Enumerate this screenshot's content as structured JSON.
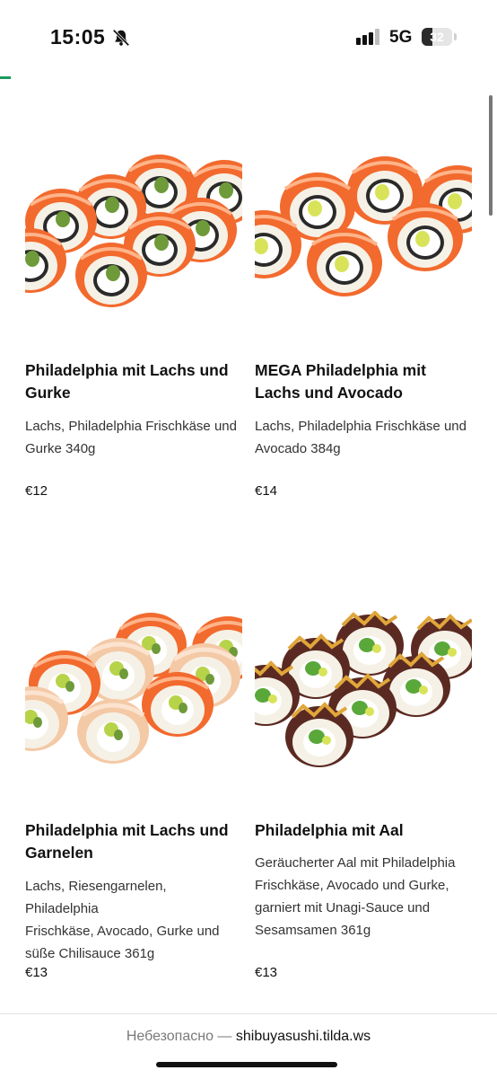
{
  "status_bar": {
    "time": "15:05",
    "network": "5G",
    "battery": "32",
    "icons": [
      "bell-slash-icon",
      "signal-icon",
      "battery-icon"
    ]
  },
  "colors": {
    "accent": "#1a9a5c",
    "salmon": "#f26a2e",
    "rice": "#f5f1e6",
    "seaweed": "#2a2a2a"
  },
  "products": [
    {
      "title_line1": "Philadelphia mit Lachs und",
      "title_line2": "Gurke",
      "desc_line1": "Lachs, Philadelphia Frischkäse und",
      "desc_line2": "Gurke 340g",
      "price": "€12"
    },
    {
      "title_line1": "MEGA Philadelphia mit",
      "title_line2": "Lachs und Avocado",
      "desc_line1": "Lachs, Philadelphia Frischkäse und",
      "desc_line2": "Avocado 384g",
      "price": "€14"
    },
    {
      "title_line1": "Philadelphia mit Lachs und",
      "title_line2": "Garnelen",
      "desc_line1": "Lachs, Riesengarnelen, Philadelphia",
      "desc_line2": "Frischkäse, Avocado, Gurke und",
      "desc_line3": "süße Chilisauce 361g",
      "price": "€13"
    },
    {
      "title_line1": "Philadelphia mit Aal",
      "desc_line1": "Geräucherter Aal mit Philadelphia",
      "desc_line2": "Frischkäse, Avocado und Gurke,",
      "desc_line3": "garniert mit Unagi-Sauce und",
      "desc_line4": "Sesamsamen 361g",
      "price": "€13"
    }
  ],
  "url_bar": {
    "insecure_label": "Небезопасно —",
    "domain": "shibuyasushi.tilda.ws"
  }
}
